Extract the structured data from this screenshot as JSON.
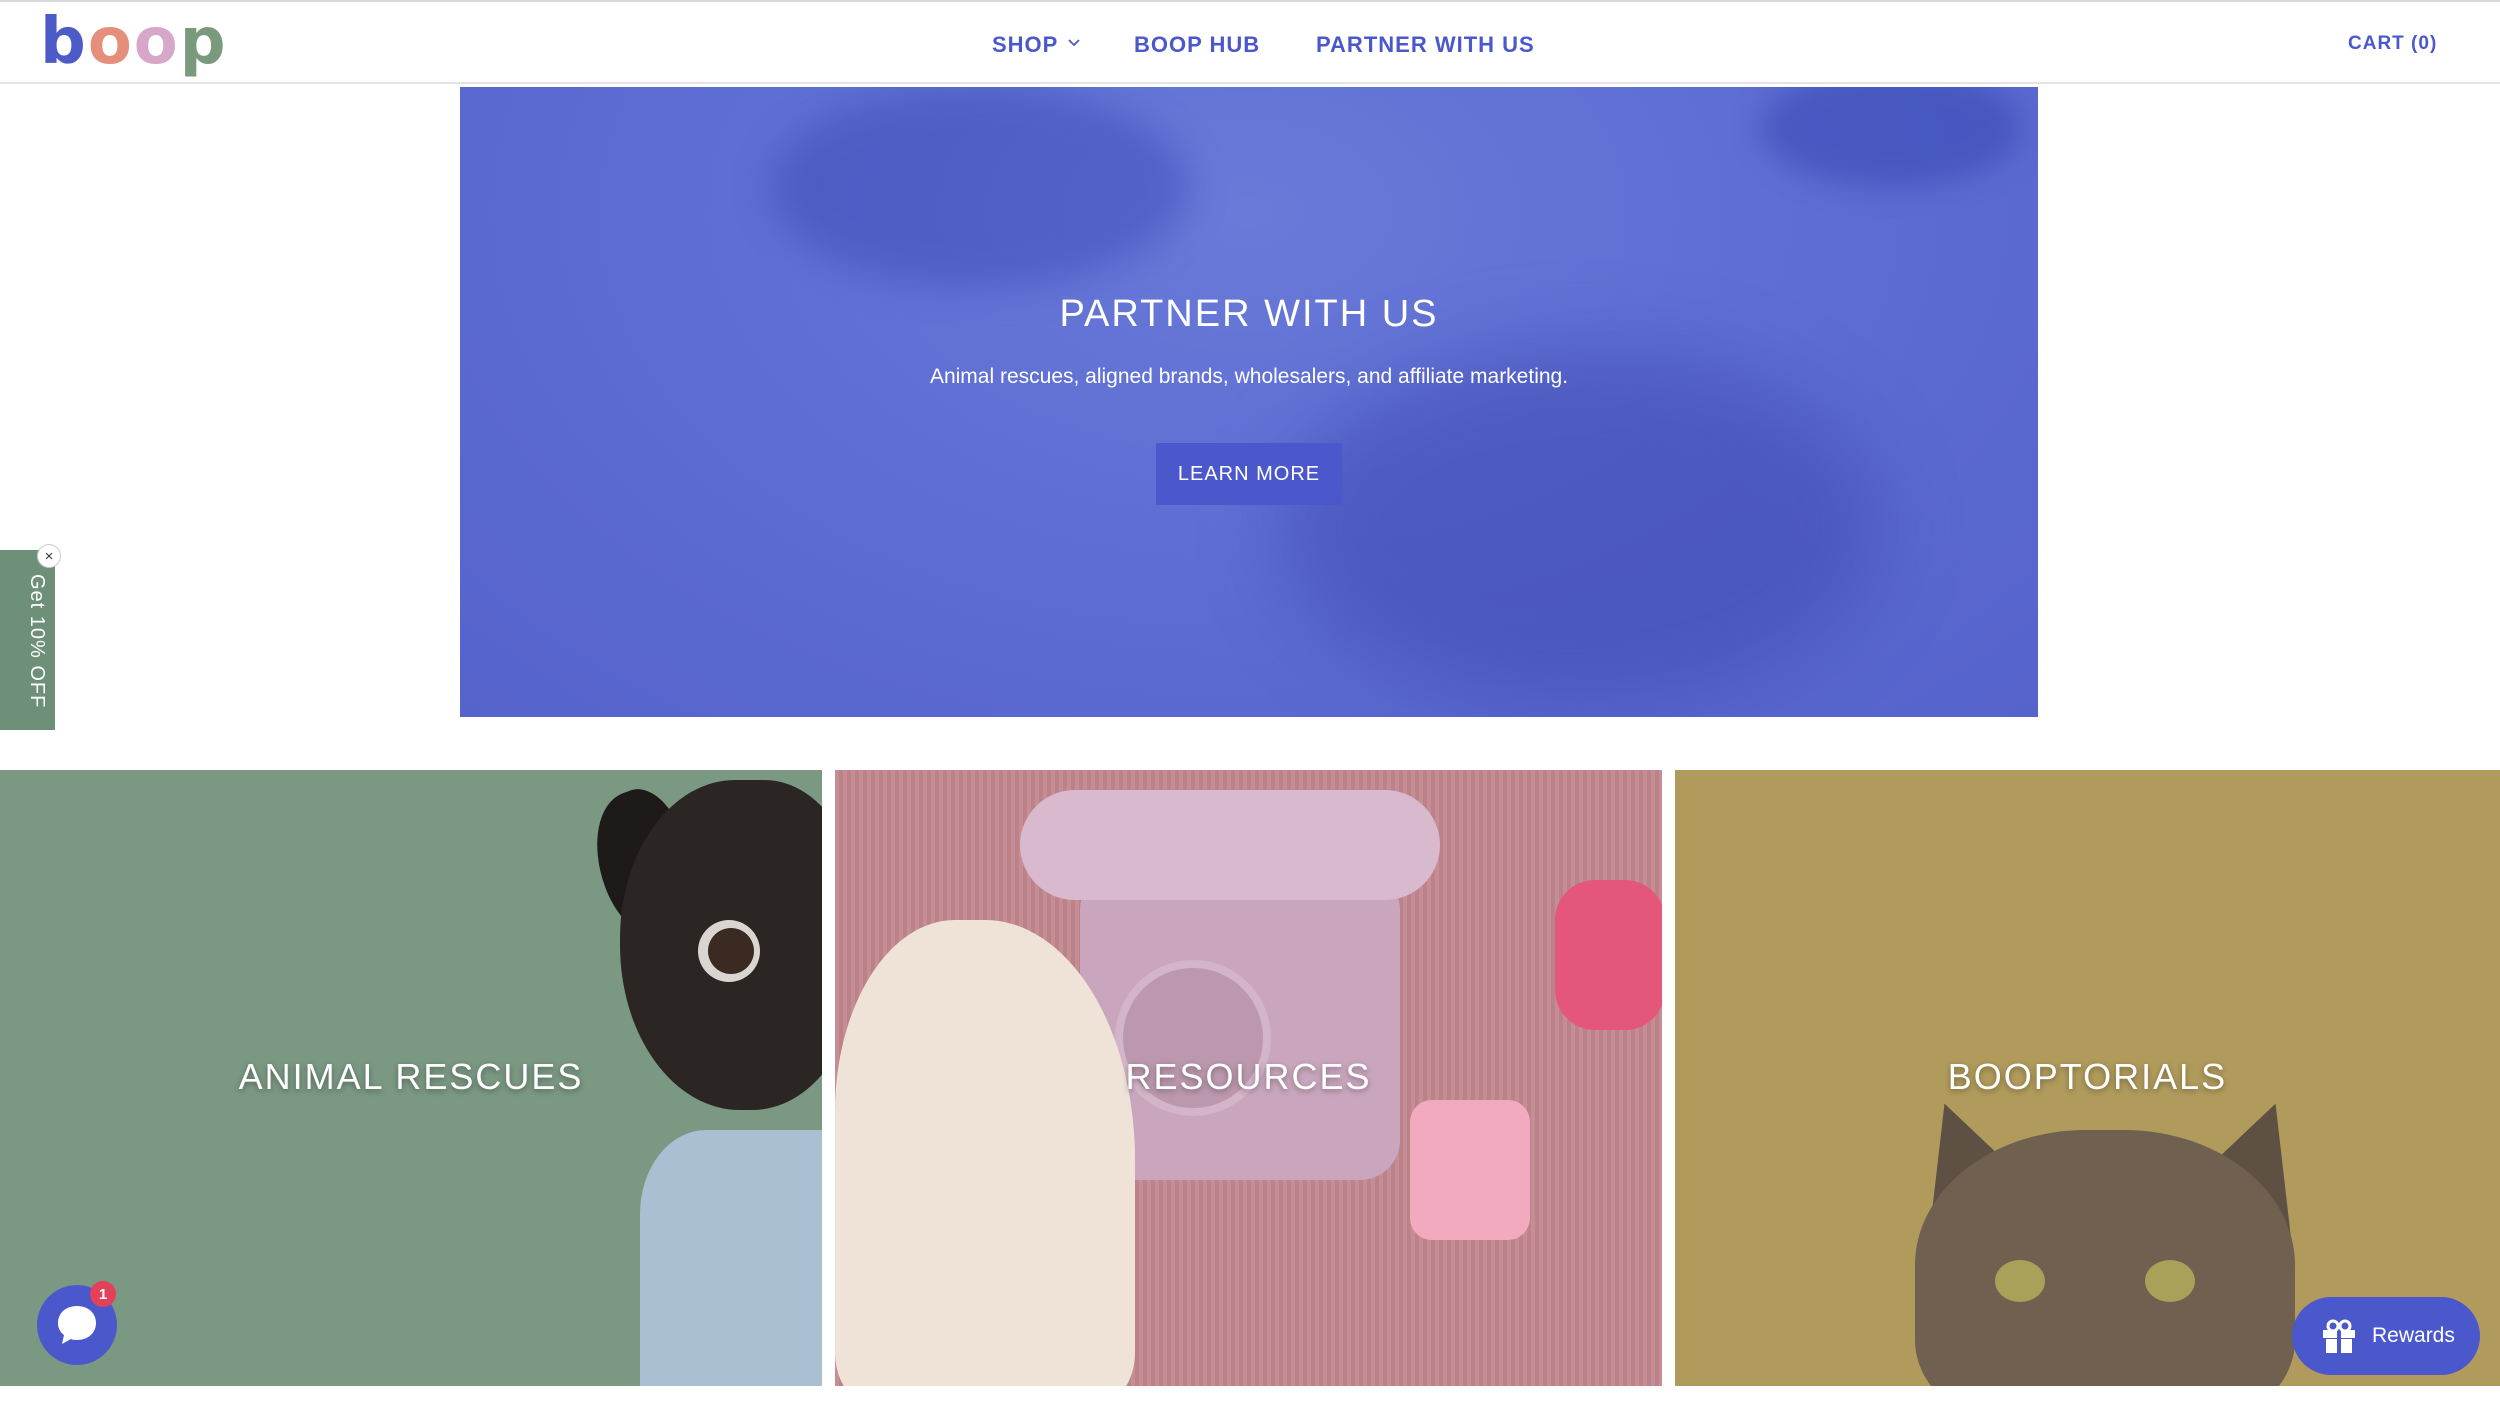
{
  "header": {
    "logo_letters": [
      "b",
      "o",
      "o",
      "p"
    ],
    "nav": {
      "shop": "SHOP",
      "hub": "BOOP HUB",
      "partner": "PARTNER WITH US"
    },
    "cart": "CART (0)"
  },
  "hero": {
    "title": "PARTNER WITH US",
    "subtitle": "Animal rescues, aligned brands, wholesalers, and affiliate marketing.",
    "button": "LEARN MORE"
  },
  "side_tab": {
    "label": "Get 10% OFF",
    "close": "×"
  },
  "tiles": [
    {
      "title": "ANIMAL RESCUES"
    },
    {
      "title": "RESOURCES"
    },
    {
      "title": "BOOPTORIALS"
    }
  ],
  "chat": {
    "badge": "1"
  },
  "rewards": {
    "label": "Rewards"
  },
  "colors": {
    "brand_blue": "#4b58cc",
    "hero_blue": "#5f6fd3",
    "sage": "#7a9882",
    "rose": "#c4878f",
    "mustard": "#b09b5c",
    "badge_red": "#e3405a"
  }
}
